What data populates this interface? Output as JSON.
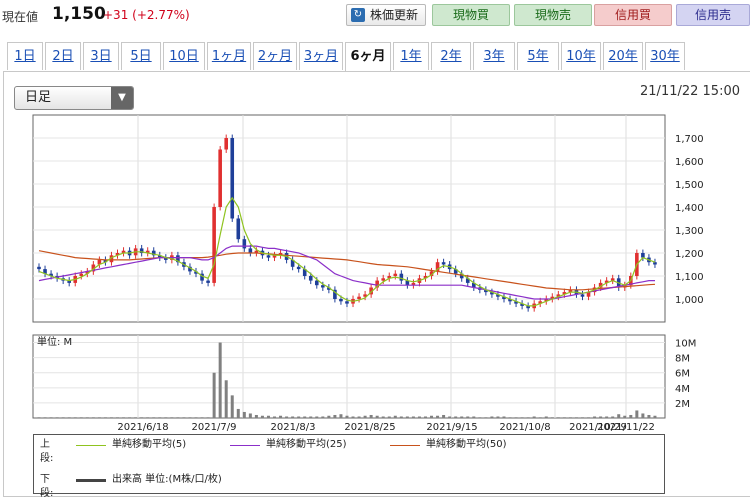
{
  "header": {
    "price_label": "現在値",
    "price": "1,150",
    "change": "+31 (+2.77%)",
    "stock_button": "株価更新",
    "buttons": [
      "現物買",
      "現物売",
      "信用買",
      "信用売"
    ]
  },
  "tabs": [
    "1日",
    "2日",
    "3日",
    "5日",
    "10日",
    "1ヶ月",
    "2ヶ月",
    "3ヶ月",
    "6ヶ月",
    "1年",
    "2年",
    "3年",
    "5年",
    "10年",
    "20年",
    "30年"
  ],
  "active_tab": "6ヶ月",
  "period_select": "日足",
  "datetime": "21/11/22 15:00",
  "colors": {
    "up": "#e03030",
    "down": "#1f3f99",
    "ma5": "#8fc31f",
    "ma25": "#8b2fc9",
    "ma50": "#c8521c",
    "volume": "#808080"
  },
  "legend": {
    "upper_label": "上段:",
    "lower_label": "下段:",
    "ma5": "単純移動平均(5)",
    "ma25": "単純移動平均(25)",
    "ma50": "単純移動平均(50)",
    "volume": "出来高 単位:(M株/口/枚)"
  },
  "chart_data": [
    {
      "type": "candlestick",
      "title": "",
      "ylim": [
        900,
        1800
      ],
      "y_ticks": [
        "1,000",
        "1,100",
        "1,200",
        "1,300",
        "1,400",
        "1,500",
        "1,600",
        "1,700"
      ],
      "x_ticks": [
        "2021/6/18",
        "2021/7/9",
        "2021/8/3",
        "2021/8/25",
        "2021/9/15",
        "2021/10/8",
        "2021/10/29",
        "2021/11/22"
      ],
      "grid": true,
      "close_series": [
        1130,
        1110,
        1100,
        1090,
        1080,
        1070,
        1100,
        1110,
        1120,
        1150,
        1170,
        1160,
        1190,
        1200,
        1210,
        1190,
        1220,
        1200,
        1210,
        1190,
        1180,
        1170,
        1190,
        1160,
        1140,
        1120,
        1110,
        1080,
        1070,
        1400,
        1650,
        1700,
        1350,
        1260,
        1220,
        1200,
        1210,
        1190,
        1180,
        1190,
        1200,
        1170,
        1140,
        1130,
        1100,
        1080,
        1060,
        1050,
        1040,
        1000,
        990,
        980,
        1000,
        1010,
        1020,
        1050,
        1080,
        1090,
        1100,
        1110,
        1080,
        1060,
        1070,
        1090,
        1100,
        1120,
        1160,
        1150,
        1130,
        1110,
        1090,
        1070,
        1050,
        1040,
        1030,
        1020,
        1010,
        1000,
        990,
        980,
        970,
        960,
        980,
        990,
        1000,
        1010,
        1020,
        1030,
        1040,
        1020,
        1010,
        1030,
        1050,
        1070,
        1080,
        1090,
        1050,
        1060,
        1100,
        1200,
        1180,
        1160,
        1150
      ],
      "ma5": [
        1120,
        1110,
        1100,
        1090,
        1085,
        1080,
        1085,
        1095,
        1110,
        1130,
        1150,
        1160,
        1180,
        1190,
        1200,
        1200,
        1205,
        1205,
        1200,
        1195,
        1190,
        1180,
        1175,
        1165,
        1150,
        1135,
        1120,
        1100,
        1090,
        1150,
        1280,
        1400,
        1440,
        1400,
        1300,
        1240,
        1215,
        1200,
        1195,
        1190,
        1190,
        1185,
        1170,
        1150,
        1130,
        1110,
        1085,
        1065,
        1050,
        1030,
        1010,
        995,
        990,
        995,
        1005,
        1030,
        1055,
        1075,
        1090,
        1095,
        1090,
        1080,
        1075,
        1080,
        1090,
        1105,
        1130,
        1145,
        1140,
        1130,
        1110,
        1090,
        1070,
        1055,
        1040,
        1030,
        1020,
        1010,
        1000,
        990,
        980,
        970,
        970,
        980,
        990,
        1000,
        1010,
        1020,
        1030,
        1030,
        1025,
        1030,
        1040,
        1055,
        1070,
        1080,
        1070,
        1060,
        1080,
        1150,
        1180,
        1170,
        1160
      ],
      "ma25": [
        1080,
        1085,
        1090,
        1095,
        1100,
        1105,
        1110,
        1115,
        1120,
        1125,
        1130,
        1135,
        1140,
        1145,
        1150,
        1155,
        1160,
        1165,
        1170,
        1175,
        1180,
        1180,
        1180,
        1180,
        1180,
        1180,
        1175,
        1170,
        1170,
        1180,
        1200,
        1220,
        1230,
        1230,
        1230,
        1230,
        1230,
        1225,
        1220,
        1220,
        1215,
        1210,
        1205,
        1200,
        1190,
        1180,
        1170,
        1150,
        1130,
        1110,
        1100,
        1090,
        1080,
        1075,
        1070,
        1065,
        1060,
        1060,
        1060,
        1060,
        1060,
        1060,
        1060,
        1060,
        1060,
        1060,
        1060,
        1060,
        1060,
        1060,
        1060,
        1055,
        1050,
        1045,
        1040,
        1035,
        1030,
        1025,
        1020,
        1015,
        1010,
        1005,
        1000,
        1000,
        1000,
        1000,
        1005,
        1010,
        1015,
        1020,
        1025,
        1030,
        1035,
        1040,
        1045,
        1050,
        1055,
        1060,
        1065,
        1070,
        1075,
        1080,
        1080
      ],
      "ma50": [
        1210,
        1205,
        1200,
        1195,
        1190,
        1185,
        1180,
        1178,
        1176,
        1174,
        1172,
        1170,
        1170,
        1170,
        1170,
        1170,
        1172,
        1174,
        1176,
        1178,
        1180,
        1180,
        1180,
        1180,
        1180,
        1180,
        1180,
        1180,
        1182,
        1186,
        1190,
        1195,
        1198,
        1200,
        1200,
        1200,
        1200,
        1198,
        1196,
        1194,
        1192,
        1190,
        1188,
        1186,
        1184,
        1182,
        1180,
        1178,
        1176,
        1174,
        1172,
        1170,
        1166,
        1162,
        1158,
        1154,
        1150,
        1148,
        1146,
        1144,
        1142,
        1140,
        1136,
        1132,
        1128,
        1124,
        1120,
        1116,
        1112,
        1108,
        1104,
        1100,
        1096,
        1092,
        1088,
        1084,
        1080,
        1076,
        1072,
        1068,
        1064,
        1060,
        1056,
        1052,
        1048,
        1046,
        1044,
        1042,
        1040,
        1040,
        1040,
        1042,
        1044,
        1046,
        1048,
        1050,
        1052,
        1054,
        1056,
        1058,
        1060,
        1062,
        1064
      ]
    },
    {
      "type": "bar",
      "title": "",
      "unit_label": "単位: M",
      "ylim": [
        0,
        11
      ],
      "y_ticks": [
        "2M",
        "4M",
        "6M",
        "8M",
        "10M"
      ],
      "values": [
        0.1,
        0.1,
        0.1,
        0.1,
        0.1,
        0.1,
        0.1,
        0.1,
        0.1,
        0.1,
        0.1,
        0.1,
        0.1,
        0.1,
        0.1,
        0.1,
        0.1,
        0.1,
        0.1,
        0.1,
        0.1,
        0.1,
        0.1,
        0.1,
        0.1,
        0.1,
        0.1,
        0.1,
        0.1,
        6,
        10,
        5,
        3,
        1.2,
        0.8,
        0.6,
        0.4,
        0.3,
        0.3,
        0.2,
        0.3,
        0.2,
        0.2,
        0.2,
        0.2,
        0.2,
        0.2,
        0.2,
        0.3,
        0.4,
        0.5,
        0.3,
        0.2,
        0.2,
        0.3,
        0.4,
        0.3,
        0.2,
        0.2,
        0.3,
        0.2,
        0.2,
        0.2,
        0.2,
        0.2,
        0.3,
        0.3,
        0.4,
        0.2,
        0.2,
        0.2,
        0.2,
        0.2,
        0.1,
        0.1,
        0.2,
        0.2,
        0.2,
        0.1,
        0.1,
        0.1,
        0.1,
        0.2,
        0.1,
        0.2,
        0.1,
        0.1,
        0.1,
        0.1,
        0.1,
        0.1,
        0.1,
        0.2,
        0.2,
        0.2,
        0.2,
        0.5,
        0.3,
        0.4,
        1.0,
        0.6,
        0.4,
        0.3
      ]
    }
  ]
}
